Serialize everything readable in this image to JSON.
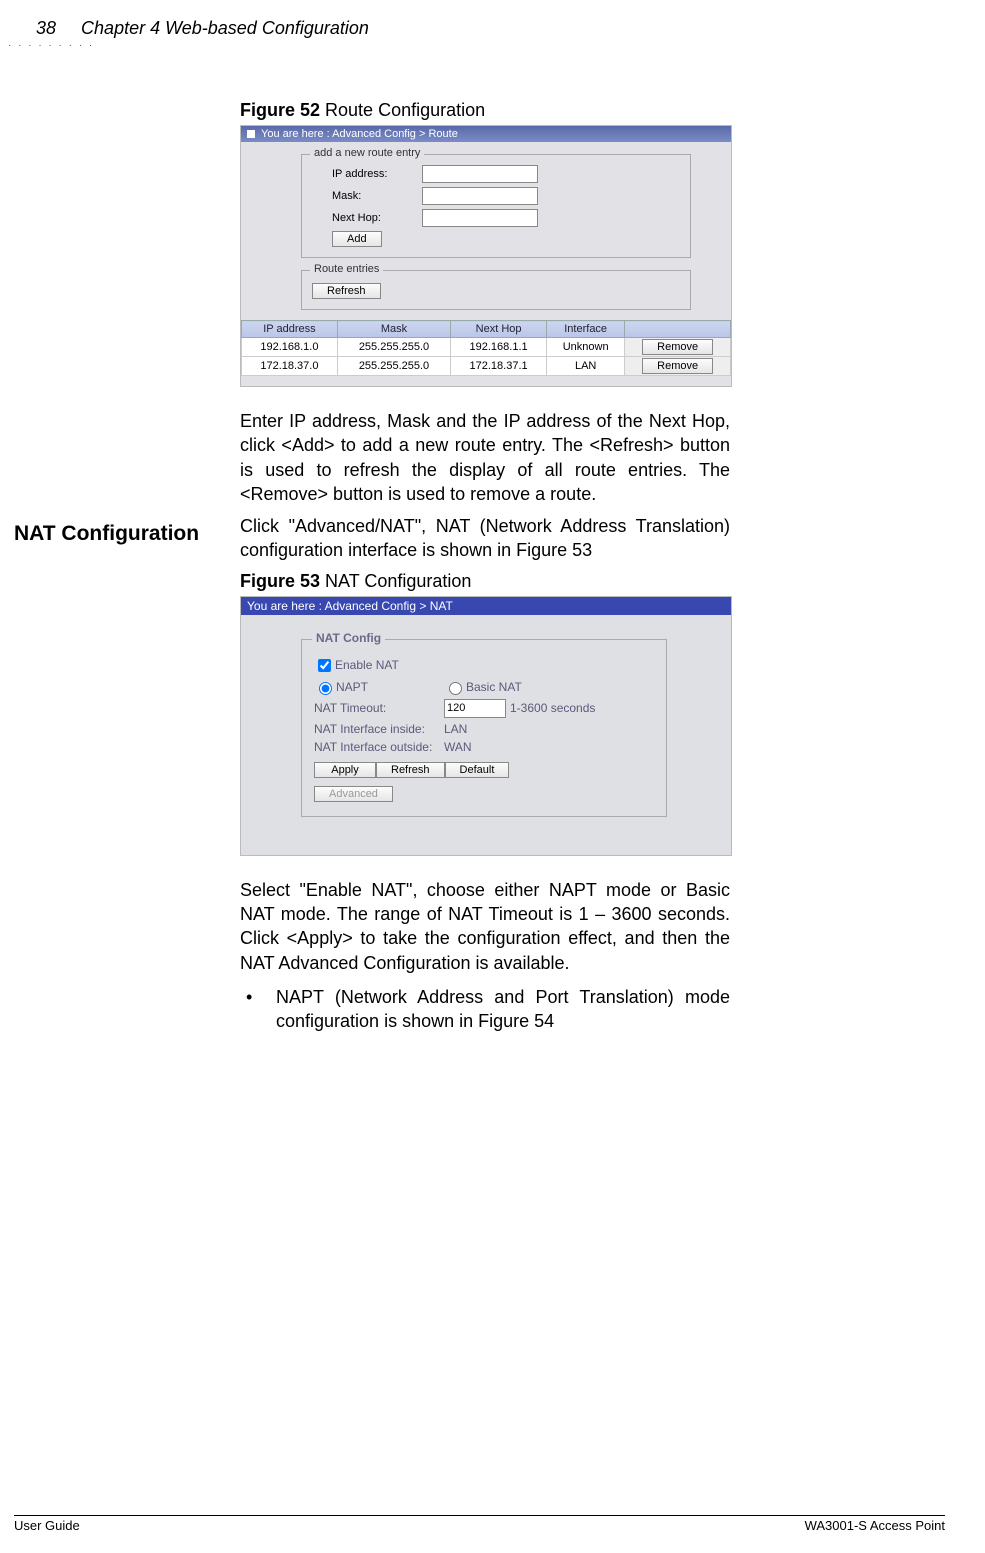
{
  "header": {
    "page_number": "38",
    "chapter_title": "Chapter 4 Web-based Configuration"
  },
  "figure52": {
    "caption_label": "Figure 52",
    "caption_text": " Route Configuration",
    "breadcrumb": "You are here : Advanced Config > Route",
    "fieldset1_legend": "add a new route entry",
    "labels": {
      "ip": "IP address:",
      "mask": "Mask:",
      "nexthop": "Next Hop:"
    },
    "add_btn": "Add",
    "fieldset2_legend": "Route entries",
    "refresh_btn": "Refresh",
    "table": {
      "headers": [
        "IP address",
        "Mask",
        "Next Hop",
        "Interface",
        ""
      ],
      "rows": [
        {
          "ip": "192.168.1.0",
          "mask": "255.255.255.0",
          "nexthop": "192.168.1.1",
          "iface": "Unknown",
          "btn": "Remove"
        },
        {
          "ip": "172.18.37.0",
          "mask": "255.255.255.0",
          "nexthop": "172.18.37.1",
          "iface": "LAN",
          "btn": "Remove"
        }
      ]
    }
  },
  "paragraph52": "Enter IP address, Mask and the IP address of the Next Hop, click <Add> to add a new route entry. The <Refresh> button is used to refresh the display of all route entries. The <Remove> button is used to remove a route.",
  "side_heading": "NAT Configuration",
  "paragraph53_intro": "Click \"Advanced/NAT\", NAT (Network Address Translation) configuration interface is shown in Figure 53",
  "figure53": {
    "caption_label": "Figure 53",
    "caption_text": " NAT Configuration",
    "breadcrumb": "You are here : Advanced Config > NAT",
    "legend": "NAT Config",
    "enable_label": "Enable NAT",
    "napt_label": "NAPT",
    "basic_label": "Basic NAT",
    "timeout_label": "NAT Timeout:",
    "timeout_value": "120",
    "timeout_hint": "1-3600 seconds",
    "inside_label": "NAT Interface inside:",
    "inside_value": "LAN",
    "outside_label": "NAT Interface outside:",
    "outside_value": "WAN",
    "apply_btn": "Apply",
    "refresh_btn": "Refresh",
    "default_btn": "Default",
    "advanced_btn": "Advanced"
  },
  "paragraph53_after": "Select \"Enable NAT\", choose either NAPT mode or Basic NAT mode. The range of NAT Timeout is 1 – 3600 seconds. Click <Apply> to take the configuration effect, and then the NAT Advanced Configuration is available.",
  "bullet": "NAPT (Network Address and Port Translation) mode configuration is shown in Figure 54",
  "footer": {
    "left": "User Guide",
    "right": "WA3001-S Access Point"
  }
}
